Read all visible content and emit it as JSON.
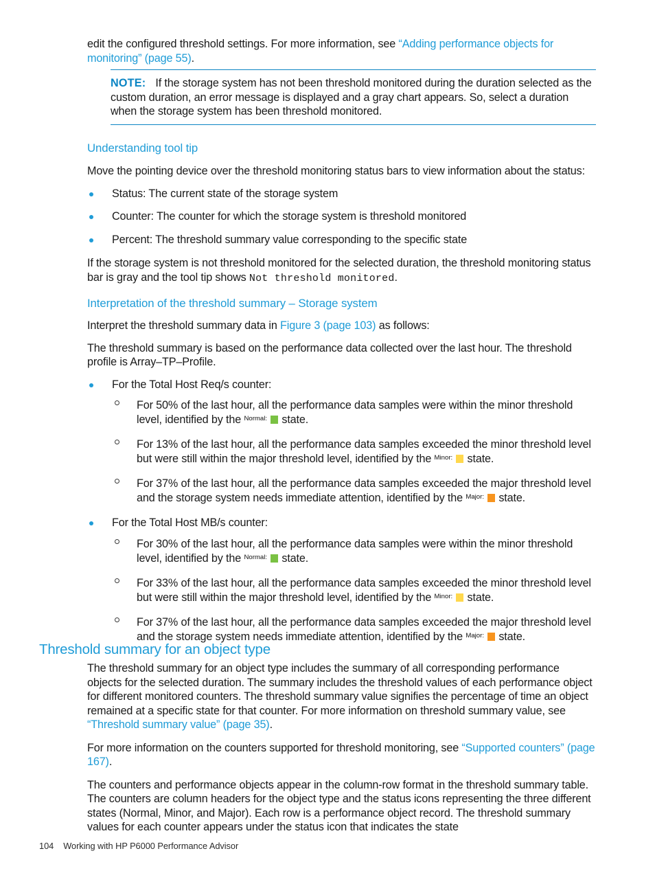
{
  "page": {
    "footer_page_number": "104",
    "footer_title": "Working with HP P6000 Performance Advisor"
  },
  "colors": {
    "link": "#1f9cd7",
    "rule": "#0b85c4",
    "normal_state": "#7ac143",
    "minor_state": "#ffd84d",
    "major_state": "#f7941e",
    "body_text": "#1a1a1a"
  },
  "intro": {
    "text_before_link": "edit the configured threshold settings. For more information, see ",
    "link": "“Adding performance objects for monitoring” (page 55)",
    "text_after_link": "."
  },
  "note": {
    "label": "NOTE:",
    "text": "If the storage system has not been threshold monitored during the duration selected as the custom duration, an error message is displayed and a gray chart appears. So, select a duration when the storage system has been threshold monitored."
  },
  "tooltip_section": {
    "heading": "Understanding tool tip",
    "intro": "Move the pointing device over the threshold monitoring status bars to view information about the status:",
    "bullets": [
      "Status: The current state of the storage system",
      "Counter: The counter for which the storage system is threshold monitored",
      "Percent: The threshold summary value corresponding to the specific state"
    ],
    "after_text_before_mono": "If the storage system is not threshold monitored for the selected duration, the threshold monitoring status bar is gray and the tool tip shows ",
    "mono_text": "Not threshold monitored",
    "after_text_after_mono": "."
  },
  "interpretation_section": {
    "heading": "Interpretation of the threshold summary – Storage system",
    "intro_before_link": "Interpret the threshold summary data in ",
    "intro_link": "Figure 3 (page 103)",
    "intro_after_link": " as follows:",
    "basis": "The threshold summary is based on the performance data collected over the last hour. The threshold profile is Array–TP–Profile.",
    "counters": [
      {
        "label": "For the Total Host Req/s counter:",
        "items": [
          {
            "text_before": "For 50% of the last hour, all the performance data samples were within the minor threshold level, identified by the ",
            "state_label": "Normal:",
            "state_kind": "normal",
            "text_after": " state.",
            "percent": "50",
            "state": "Normal"
          },
          {
            "text_before": "For 13% of the last hour, all the performance data samples exceeded the minor threshold level but were still within the major threshold level, identified by the ",
            "state_label": "Minor:",
            "state_kind": "minor",
            "text_after": " state.",
            "percent": "13",
            "state": "Minor"
          },
          {
            "text_before": "For 37% of the last hour, all the performance data samples exceeded the major threshold level and the storage system needs immediate attention, identified by the ",
            "state_label": "Major:",
            "state_kind": "major",
            "text_after": " state.",
            "percent": "37",
            "state": "Major"
          }
        ]
      },
      {
        "label": "For the Total Host MB/s counter:",
        "items": [
          {
            "text_before": "For 30% of the last hour, all the performance data samples were within the minor threshold level, identified by the ",
            "state_label": "Normal:",
            "state_kind": "normal",
            "text_after": " state.",
            "percent": "30",
            "state": "Normal"
          },
          {
            "text_before": "For 33% of the last hour, all the performance data samples exceeded the minor threshold level but were still within the major threshold level, identified by the ",
            "state_label": "Minor:",
            "state_kind": "minor",
            "text_after": " state.",
            "percent": "33",
            "state": "Minor"
          },
          {
            "text_before": "For 37% of the last hour, all the performance data samples exceeded the major threshold level and the storage system needs immediate attention, identified by the ",
            "state_label": "Major:",
            "state_kind": "major",
            "text_after": " state.",
            "percent": "37",
            "state": "Major"
          }
        ]
      }
    ]
  },
  "object_type_section": {
    "heading": "Threshold summary for an object type",
    "para1_before_link": "The threshold summary for an object type includes the summary of all corresponding performance objects for the selected duration. The summary includes the threshold values of each performance object for different monitored counters. The threshold summary value signifies the percentage of time an object remained at a specific state for that counter. For more information on threshold summary value, see ",
    "para1_link": "“Threshold summary value” (page 35)",
    "para1_after_link": ".",
    "para2_before_link": "For more information on the counters supported for threshold monitoring, see ",
    "para2_link": "“Supported counters” (page 167)",
    "para2_after_link": ".",
    "para3": "The counters and performance objects appear in the column-row format in the threshold summary table. The counters are column headers for the object type and the status icons representing the three different states (Normal, Minor, and Major). Each row is a performance object record. The threshold summary values for each counter appears under the status icon that indicates the state"
  }
}
